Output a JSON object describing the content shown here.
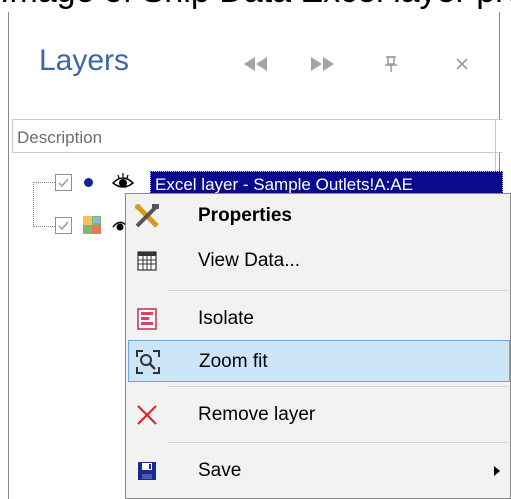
{
  "top_strip": {
    "text": "Image of Ship Data Excel layer properties"
  },
  "panel": {
    "title": "Layers",
    "header_buttons": [
      {
        "name": "rewind-icon"
      },
      {
        "name": "fast-forward-icon"
      },
      {
        "name": "pin-icon"
      },
      {
        "name": "close-icon"
      }
    ]
  },
  "columns": {
    "description": "Description"
  },
  "layers": [
    {
      "label": "Excel layer - Sample Outlets!A:AE",
      "checked": true,
      "selected": true,
      "icon": "point-layer-icon"
    },
    {
      "label": "",
      "checked": true,
      "selected": false,
      "icon": "map-layer-icon"
    }
  ],
  "context_menu": {
    "items": [
      {
        "label": "Properties",
        "icon": "tools-icon",
        "bold": true
      },
      {
        "label": "View Data...",
        "icon": "table-icon"
      },
      {
        "label": "Isolate",
        "icon": "isolate-icon"
      },
      {
        "label": "Zoom fit",
        "icon": "zoom-fit-icon",
        "highlighted": true
      },
      {
        "label": "Remove layer",
        "icon": "remove-icon"
      },
      {
        "label": "Save",
        "icon": "save-icon",
        "has_submenu": true
      }
    ]
  },
  "colors": {
    "title": "#3c67a3",
    "selection": "#0a0a8c",
    "menu_highlight": "#cde6f7",
    "remove_red": "#e02020"
  }
}
